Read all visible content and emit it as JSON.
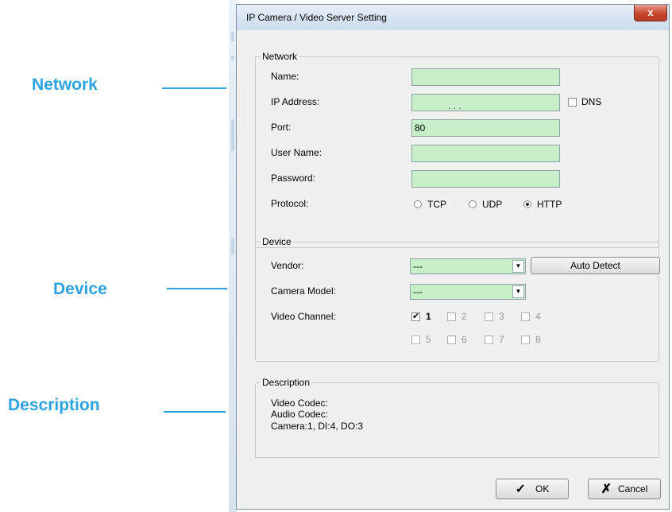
{
  "callouts": {
    "network": "Network",
    "device": "Device",
    "description": "Description"
  },
  "window": {
    "title": "IP Camera / Video Server Setting",
    "close_label": "x"
  },
  "network": {
    "group_label": "Network",
    "name_label": "Name:",
    "ip_label": "IP Address:",
    "ip_dots": ".           .           .",
    "dns_label": "DNS",
    "port_label": "Port:",
    "port_value": "80",
    "user_label": "User Name:",
    "password_label": "Password:",
    "protocol_label": "Protocol:",
    "protocols": [
      {
        "label": "TCP",
        "selected": false
      },
      {
        "label": "UDP",
        "selected": false
      },
      {
        "label": "HTTP",
        "selected": true
      }
    ]
  },
  "device": {
    "group_label": "Device",
    "vendor_label": "Vendor:",
    "vendor_value": "---",
    "auto_detect_label": "Auto Detect",
    "model_label": "Camera Model:",
    "model_value": "---",
    "channel_label": "Video Channel:",
    "channels": [
      "1",
      "2",
      "3",
      "4",
      "5",
      "6",
      "7",
      "8"
    ]
  },
  "description": {
    "group_label": "Description",
    "video_codec": "Video Codec:",
    "audio_codec": "Audio Codec:",
    "camera_info": "Camera:1, DI:4, DO:3"
  },
  "buttons": {
    "ok_label": "OK",
    "cancel_label": "Cancel"
  },
  "colors": {
    "accent": "#2ea3e3",
    "input_bg": "#c8f0c8"
  }
}
